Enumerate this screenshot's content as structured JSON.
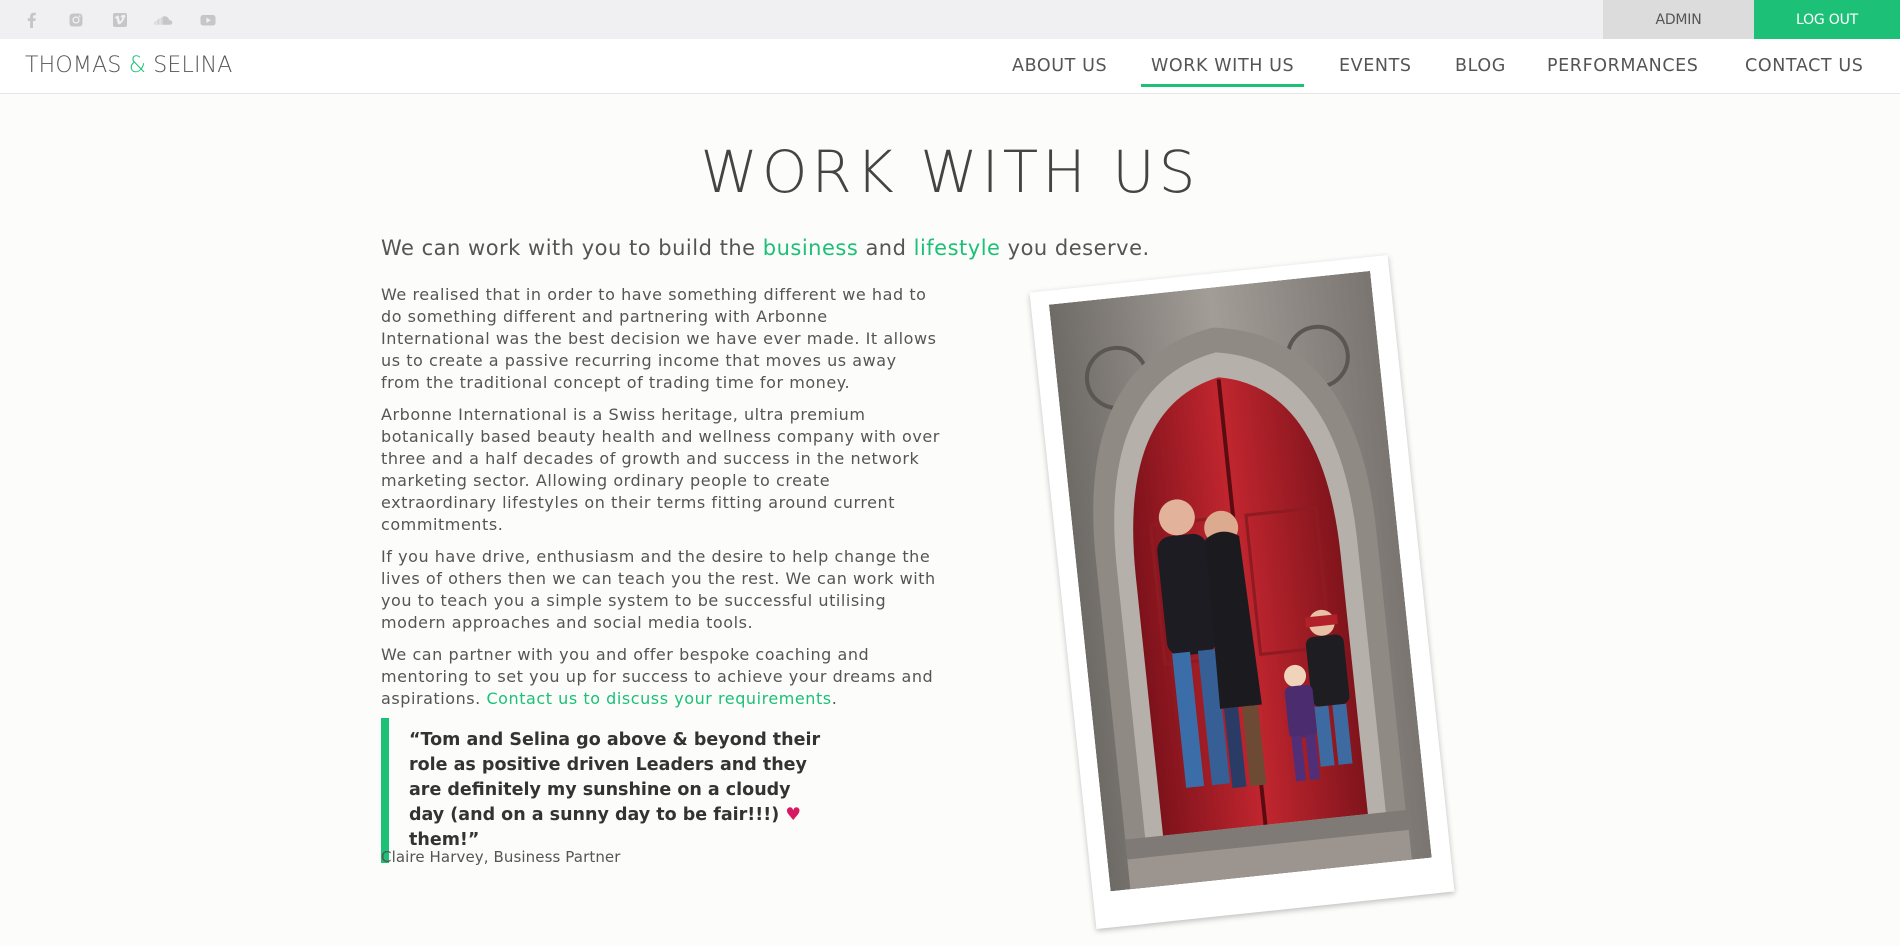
{
  "topbar": {
    "social_icons": [
      "facebook-icon",
      "instagram-icon",
      "vimeo-icon",
      "soundcloud-icon",
      "youtube-icon"
    ],
    "admin_label": "ADMIN",
    "logout_label": "LOG OUT"
  },
  "header": {
    "logo_part1": "THOMAS ",
    "logo_amp": "&",
    "logo_part2": " SELINA",
    "nav": [
      {
        "label": "ABOUT US"
      },
      {
        "label": "WORK WITH US"
      },
      {
        "label": "EVENTS"
      },
      {
        "label": "BLOG"
      },
      {
        "label": "PERFORMANCES"
      },
      {
        "label": "CONTACT US"
      }
    ],
    "active_nav": "WORK WITH US"
  },
  "main": {
    "title": "WORK WITH US",
    "lead": {
      "part1": "We can work with you to build the ",
      "accent1": "business",
      "part2": " and ",
      "accent2": "lifestyle",
      "part3": " you deserve."
    },
    "paragraphs": [
      "We realised that in order to have something different we had to do something different and partnering with Arbonne International was the best decision we have ever made. It allows us to create a passive recurring income that moves us away from the traditional concept of trading time for money.",
      "Arbonne International is a Swiss heritage, ultra premium botanically based beauty health and wellness company with over three and a half decades of growth and success in the network marketing sector. Allowing ordinary people to create extraordinary lifestyles on their terms fitting around current commitments.",
      "If you have drive, enthusiasm and the desire to help change the lives of others then we can teach you the rest. We can work with you to teach you a simple system to be successful utilising modern approaches and social media tools.",
      "We can partner with you and offer bespoke coaching and mentoring to set you up for success to achieve your dreams and aspirations. "
    ],
    "contact_link": "Contact us to discuss your requirements",
    "contact_link_suffix": ".",
    "quote": {
      "text_before_heart": "“Tom and Selina go above & beyond their role as positive driven Leaders and they are definitely my sunshine on a cloudy day (and on a sunny day to be fair!!!) ",
      "heart": "♥",
      "text_after_heart": " them!”",
      "attribution": "Claire Harvey, Business Partner"
    }
  },
  "colors": {
    "accent": "#1cc077",
    "heart": "#d81b60",
    "door_red": "#b3202c",
    "stone": "#8a8580"
  }
}
